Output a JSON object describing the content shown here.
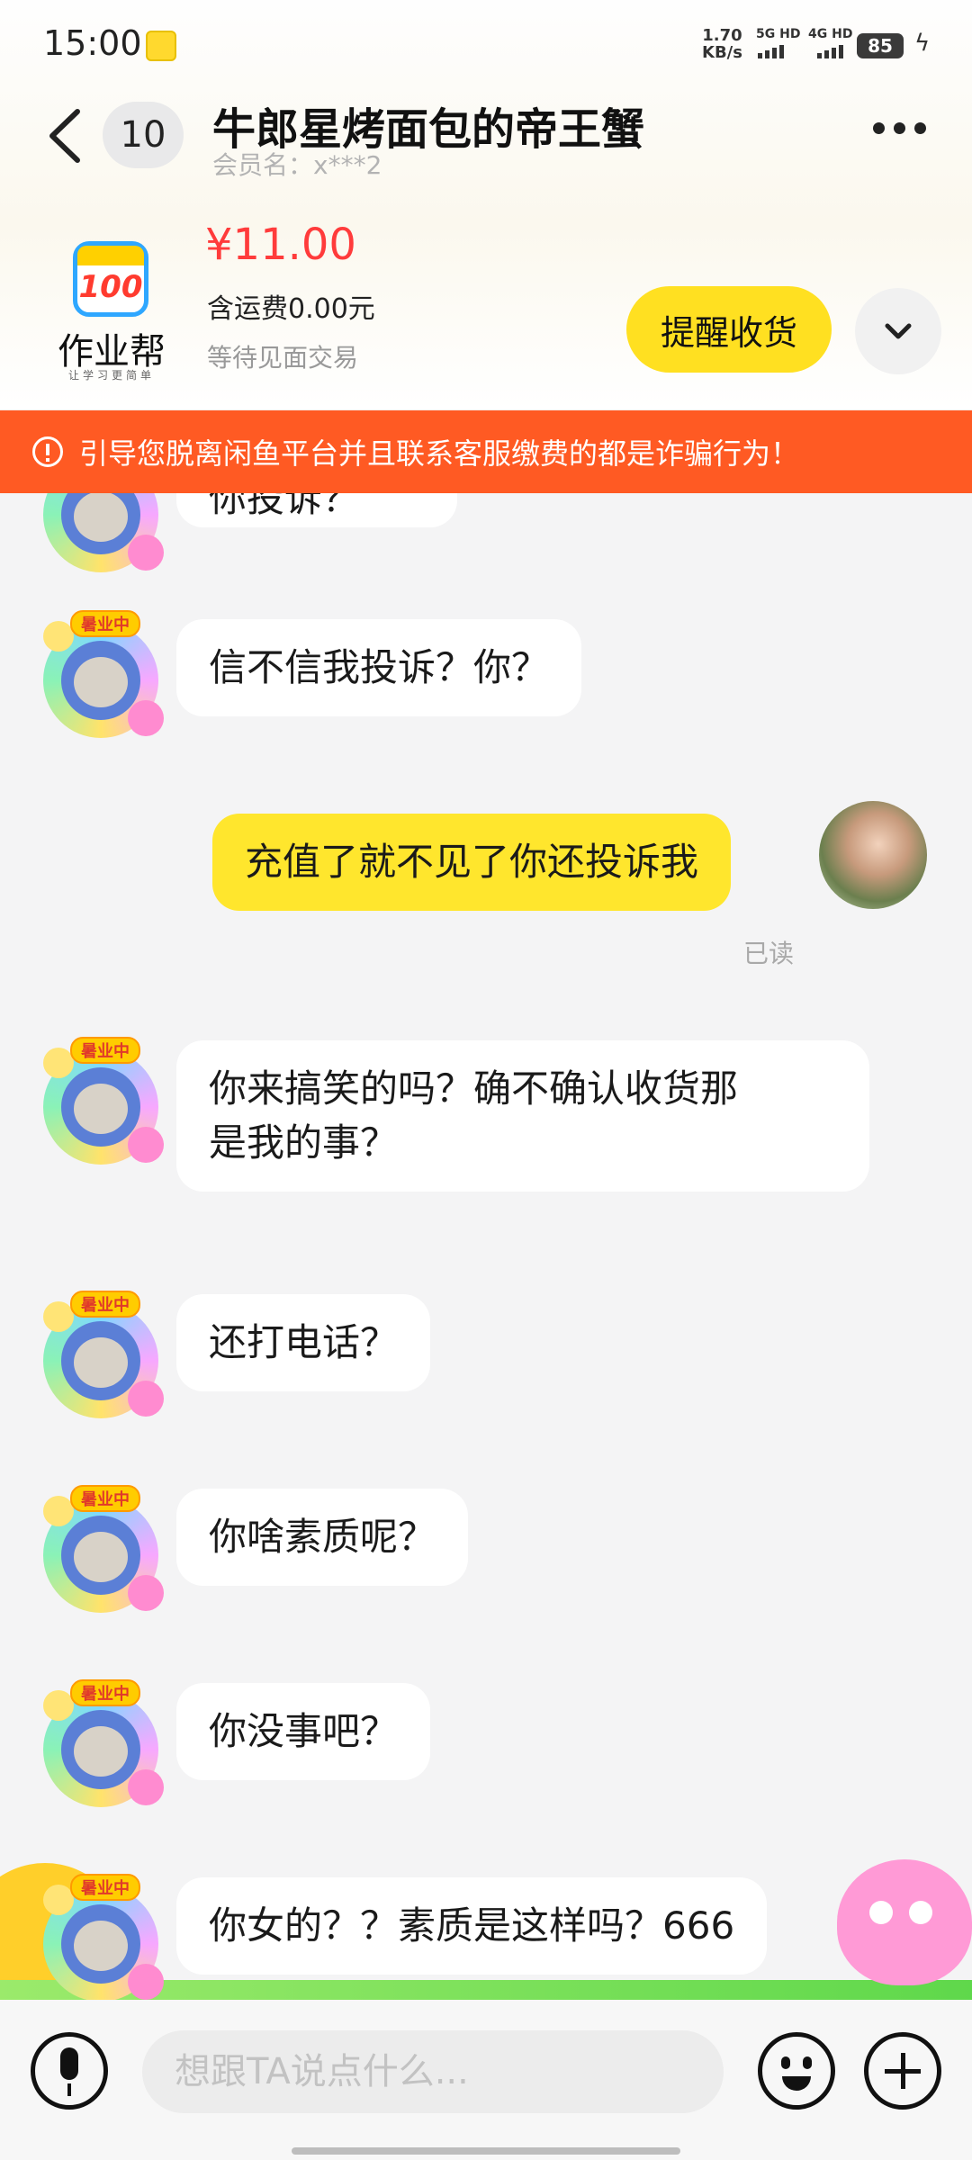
{
  "status_bar": {
    "time": "15:00",
    "net_speed_value": "1.70",
    "net_speed_unit": "KB/s",
    "signal_1": "5G HD",
    "signal_2": "4G HD",
    "battery": "85"
  },
  "header": {
    "unread_count": "10",
    "title": "牛郎星烤面包的帝王蟹",
    "member_name": "会员名：x***2"
  },
  "product": {
    "logo_number": "100",
    "logo_text": "作业帮",
    "logo_slogan": "让学习更简单",
    "price": "¥11.00",
    "shipping": "含运费0.00元",
    "status": "等待见面交易",
    "remind_button": "提醒收货"
  },
  "warning": "引导您脱离闲鱼平台并且联系客服缴费的都是诈骗行为！",
  "avatar_tag": "暑业中",
  "messages": [
    {
      "sender": "other",
      "text": "你投诉？"
    },
    {
      "sender": "other",
      "text": "信不信我投诉？你？"
    },
    {
      "sender": "me",
      "text": "充值了就不见了你还投诉我",
      "read": "已读"
    },
    {
      "sender": "other",
      "lines": [
        "你来搞笑的吗？确不确认收货那",
        "是我的事？"
      ]
    },
    {
      "sender": "other",
      "text": "还打电话？"
    },
    {
      "sender": "other",
      "text": "你啥素质呢？"
    },
    {
      "sender": "other",
      "text": "你没事吧？"
    },
    {
      "sender": "other",
      "text": "你女的？？素质是这样吗？666"
    }
  ],
  "input": {
    "placeholder": "想跟TA说点什么..."
  }
}
